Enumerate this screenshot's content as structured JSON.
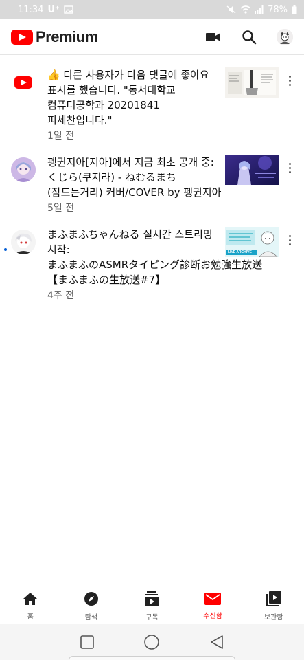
{
  "status_bar": {
    "time": "11:34",
    "carrier": "U⁺",
    "battery": "78%"
  },
  "app_bar": {
    "logo_text": "Premium",
    "icons": [
      "camera-icon",
      "search-icon",
      "account-avatar"
    ]
  },
  "notifications": [
    {
      "text": "👍 다른 사용자가 다음 댓글에 좋아요 표시를 했습니다. \"동서대학교 컴퓨터공학과 20201841 피세찬입니다.\"",
      "time": "1일 전",
      "unread": false,
      "avatar": "youtube-logo"
    },
    {
      "text": "펭귄지아[지아]에서 지금 최초 공개 중: くじら(쿠지라) - ねむるまち(잠드는거리) 커버/COVER by 펭귄지아",
      "time": "5일 전",
      "unread": false,
      "avatar": "channel-avatar"
    },
    {
      "text": "まふまふちゃんねる 실시간 스트리밍 시작: まふまふのASMRタイピング診断お勉強生放送【まふまふの生放送#7】",
      "time": "4주 전",
      "unread": true,
      "avatar": "channel-avatar",
      "thumb_badge": "LIVE ARCHIVE"
    }
  ],
  "bottom_nav": [
    {
      "label": "홈",
      "icon": "home-icon",
      "active": false
    },
    {
      "label": "탐색",
      "icon": "explore-icon",
      "active": false
    },
    {
      "label": "구독",
      "icon": "subscriptions-icon",
      "active": false
    },
    {
      "label": "수신함",
      "icon": "inbox-icon",
      "active": true
    },
    {
      "label": "보관함",
      "icon": "library-icon",
      "active": false
    }
  ],
  "colors": {
    "brand_red": "#ff0000",
    "unread_dot": "#065fd4",
    "secondary_text": "#606060"
  }
}
